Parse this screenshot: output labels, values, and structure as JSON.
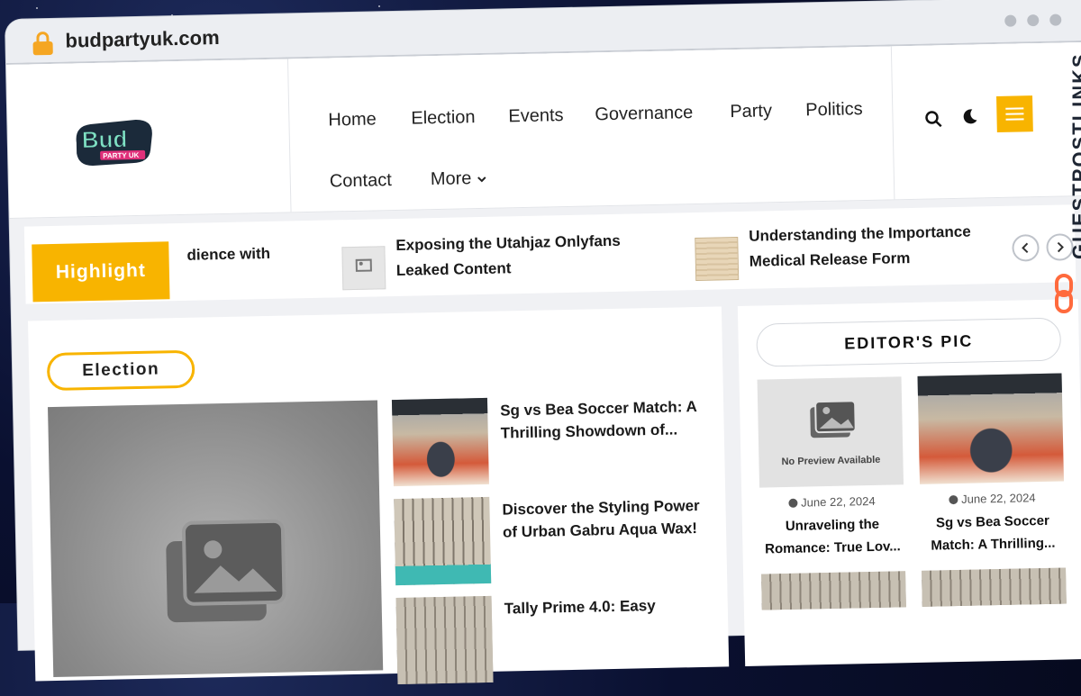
{
  "browser": {
    "url": "budpartyuk.com"
  },
  "logo": {
    "main": "Bud",
    "sub": "PARTY UK"
  },
  "nav": {
    "items": [
      "Home",
      "Election",
      "Events",
      "Governance",
      "Party",
      "Politics",
      "Contact"
    ],
    "more_label": "More"
  },
  "ticker": {
    "badge": "Highlight",
    "items": [
      {
        "title": "dience with"
      },
      {
        "title_line1": "Exposing the Utahjaz Onlyfans",
        "title_line2": "Leaked Content"
      },
      {
        "title_line1": "Understanding the Importance",
        "title_line2": "Medical Release Form"
      }
    ]
  },
  "main": {
    "category": "Election",
    "posts": [
      {
        "title": "Sg vs Bea Soccer Match: A Thrilling Showdown of..."
      },
      {
        "title": "Discover the Styling Power of Urban Gabru Aqua Wax!"
      },
      {
        "title": "Tally Prime 4.0: Easy"
      }
    ]
  },
  "aside": {
    "title": "EDITOR'S PIC",
    "cards": [
      {
        "no_preview": "No Preview Available",
        "date": "June 22, 2024",
        "title_line1": "Unraveling the",
        "title_line2": "Romance: True Lov..."
      },
      {
        "date": "June 22, 2024",
        "title_line1": "Sg vs Bea Soccer",
        "title_line2": "Match: A Thrilling..."
      }
    ]
  },
  "side_brand": {
    "text": "GUESTPOSTLINKS"
  },
  "colors": {
    "accent": "#f8b400",
    "text": "#1a1a1a",
    "frame": "#eceef2"
  }
}
